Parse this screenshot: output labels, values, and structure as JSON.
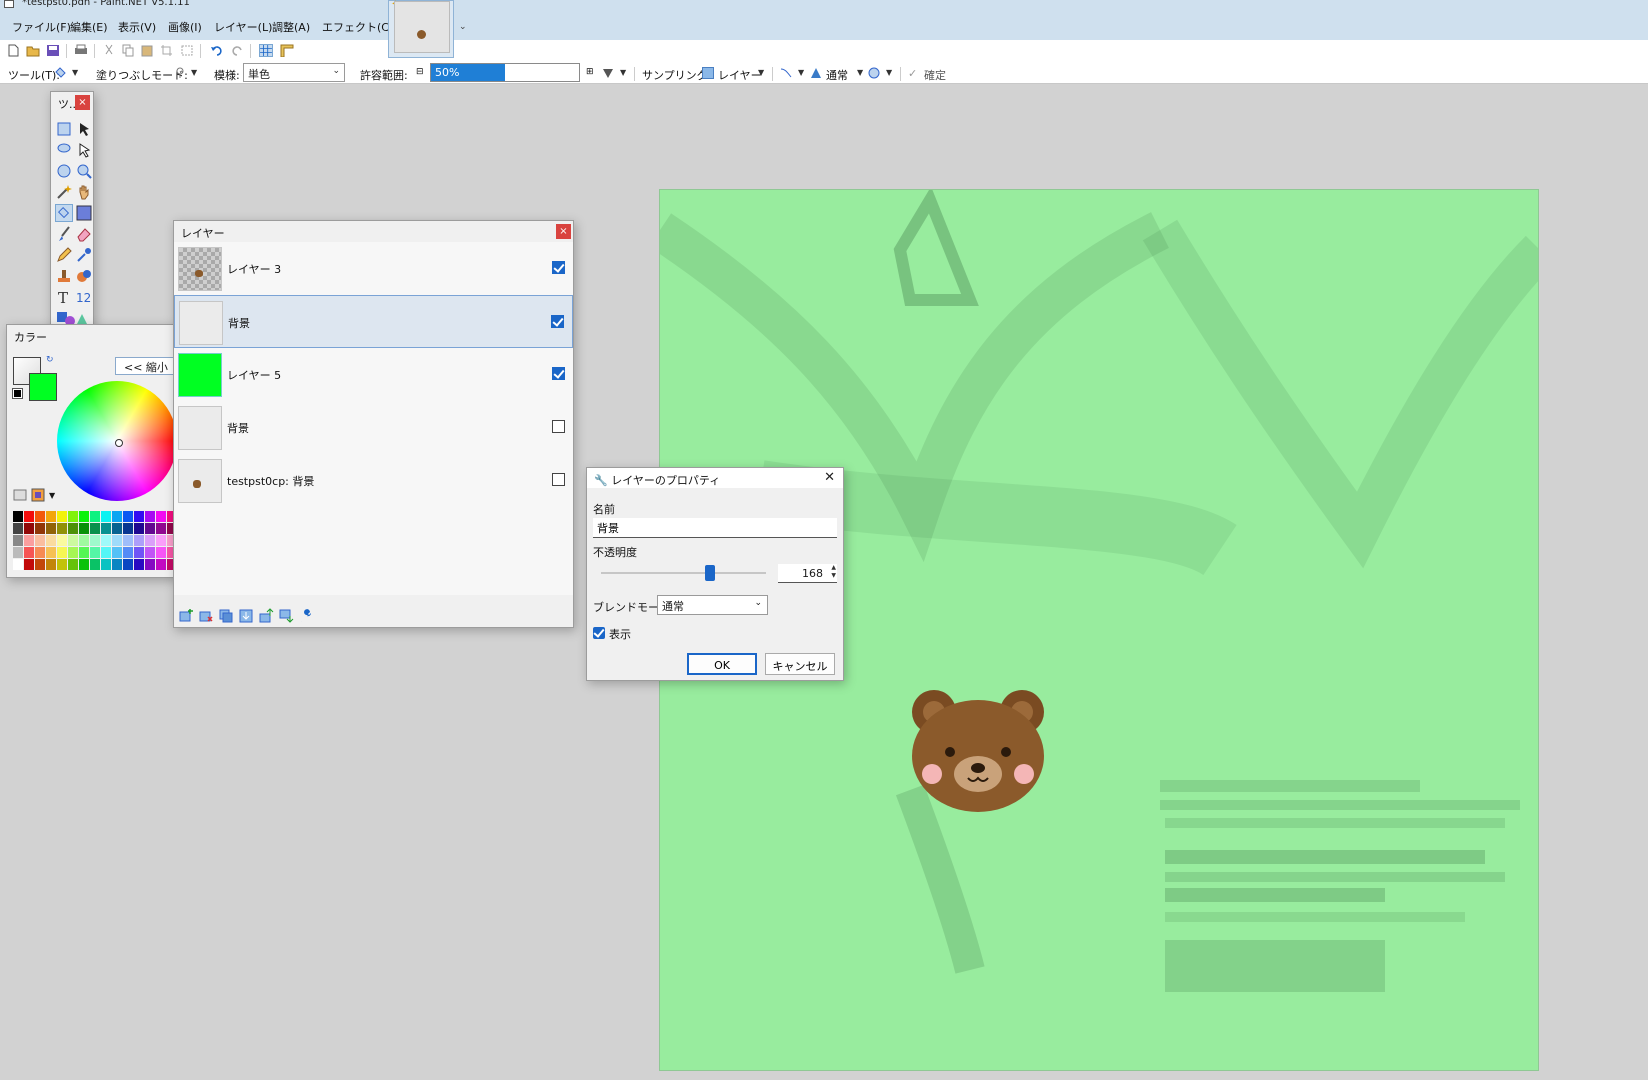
{
  "window": {
    "title": "*testpst0.pdn - Paint.NET V5.1.11"
  },
  "menu": [
    "ファイル(F)",
    "編集(E)",
    "表示(V)",
    "画像(I)",
    "レイヤー(L)",
    "調整(A)",
    "エフェクト(C)"
  ],
  "toolbar2": {
    "tool_label": "ツール(T):",
    "fill_mode_label": "塗りつぶしモード:",
    "pattern_label": "模様:",
    "pattern_value": "単色",
    "tolerance_label": "許容範囲:",
    "tolerance_text": "50%",
    "tolerance_fraction": 0.5,
    "sampling_label": "サンプリング:",
    "sampling_value": "レイヤー",
    "blend_value": "通常",
    "commit_label": "確定"
  },
  "tools_window": {
    "title": "ツ..."
  },
  "colors_window": {
    "title": "カラー",
    "shrink_label": "<< 縮小",
    "primary_color": "#ffffff",
    "secondary_color": "#00ff22"
  },
  "layers_window": {
    "title": "レイヤー",
    "layers": [
      {
        "name": "レイヤー 3",
        "visible": true,
        "selected": false,
        "thumb": "checker"
      },
      {
        "name": "背景",
        "visible": true,
        "selected": true,
        "thumb": "doc"
      },
      {
        "name": "レイヤー 5",
        "visible": true,
        "selected": false,
        "thumb": "green"
      },
      {
        "name": "背景",
        "visible": false,
        "selected": false,
        "thumb": "doc"
      },
      {
        "name": "testpst0cp: 背景",
        "visible": false,
        "selected": false,
        "thumb": "doc-bear"
      }
    ]
  },
  "layer_properties": {
    "title": "レイヤーのプロパティ",
    "name_label": "名前",
    "name_value": "背景",
    "opacity_label": "不透明度",
    "opacity_value": "168",
    "opacity_fraction": 0.66,
    "blend_label": "ブレンドモード:",
    "blend_value": "通常",
    "visible_label": "表示",
    "ok_label": "OK",
    "cancel_label": "キャンセル"
  },
  "colors": {
    "canvas_bg": "#98ec9e",
    "accent": "#1a66c8",
    "close_red": "#d9433f"
  }
}
